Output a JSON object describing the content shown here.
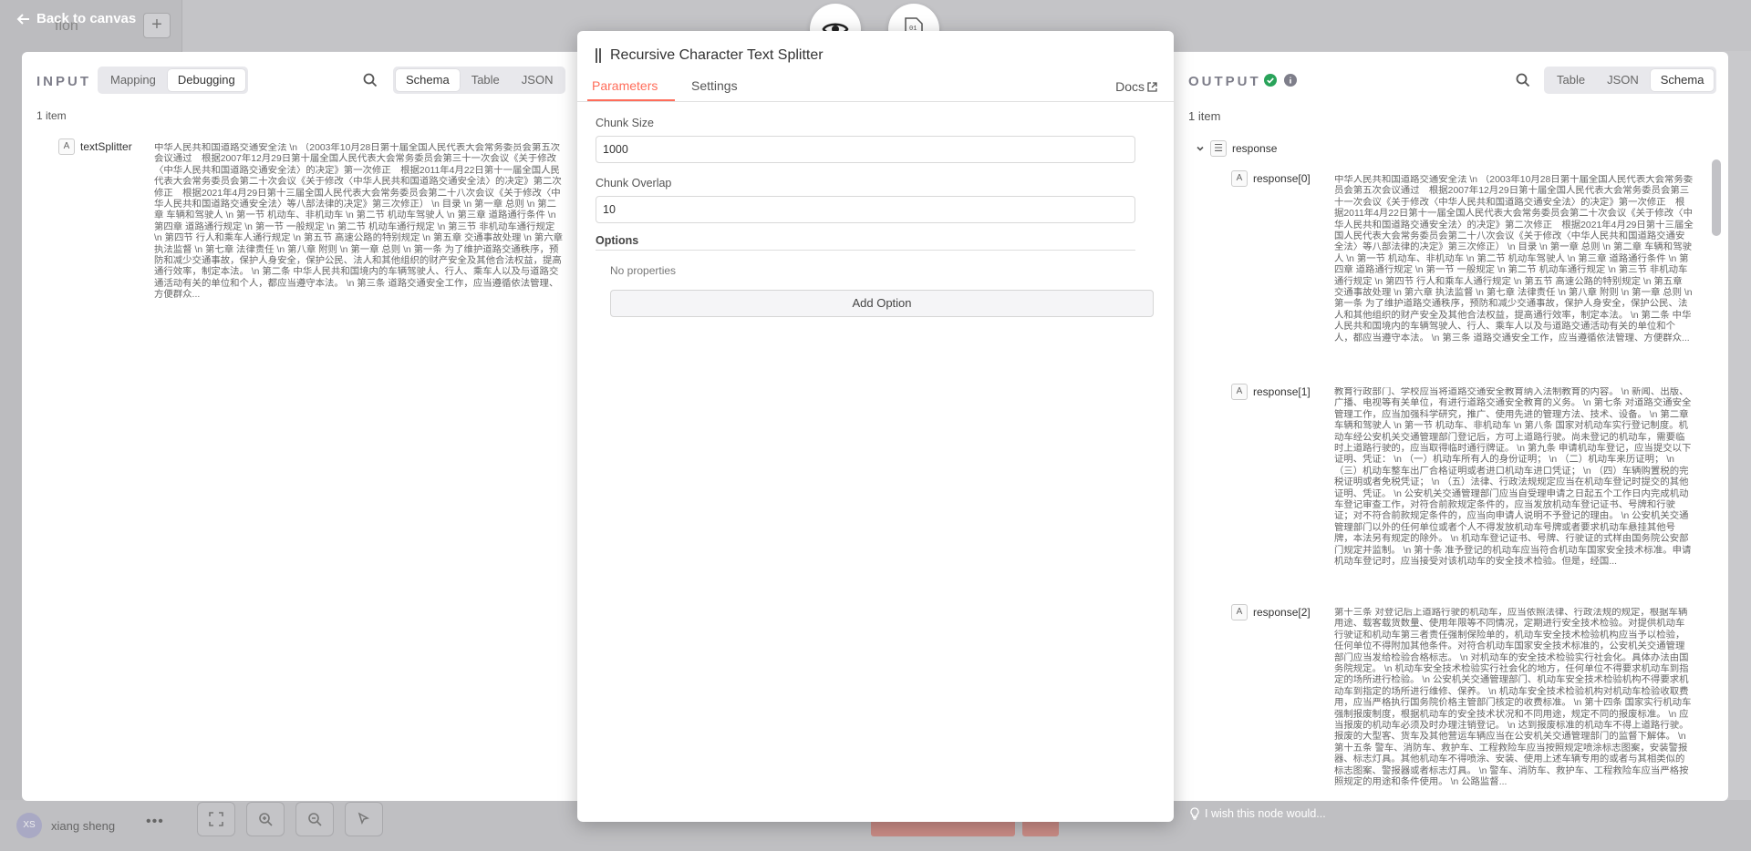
{
  "background": {
    "back_label": "Back to canvas",
    "workflow_title": "flon",
    "add_tab": "+",
    "user_name": "xiang sheng",
    "user_initials": "XS",
    "user_more": "•••"
  },
  "modal": {
    "title": "Recursive Character Text Splitter",
    "tabs": [
      "Parameters",
      "Settings"
    ],
    "docs_label": "Docs",
    "chunk_size_label": "Chunk Size",
    "chunk_size_value": "1000",
    "chunk_overlap_label": "Chunk Overlap",
    "chunk_overlap_value": "10",
    "options_label": "Options",
    "no_properties": "No properties",
    "add_option": "Add Option"
  },
  "input_panel": {
    "title": "INPUT",
    "mode_tabs": [
      "Mapping",
      "Debugging"
    ],
    "active_mode": "Debugging",
    "view_tabs": [
      "Schema",
      "Table",
      "JSON"
    ],
    "active_view": "Schema",
    "count": "1 item",
    "field_type": "A",
    "field_name": "textSplitter",
    "field_value": "中华人民共和国道路交通安全法 \\n （2003年10月28日第十届全国人民代表大会常务委员会第五次会议通过　根据2007年12月29日第十届全国人民代表大会常务委员会第三十一次会议《关于修改〈中华人民共和国道路交通安全法〉的决定》第一次修正　根据2011年4月22日第十一届全国人民代表大会常务委员会第二十次会议《关于修改〈中华人民共和国道路交通安全法〉的决定》第二次修正　根据2021年4月29日第十三届全国人民代表大会常务委员会第二十八次会议《关于修改〈中华人民共和国道路交通安全法〉等八部法律的决定》第三次修正） \\n 目录 \\n 第一章 总则 \\n 第二章 车辆和驾驶人 \\n 第一节 机动车、非机动车 \\n 第二节 机动车驾驶人 \\n 第三章 道路通行条件 \\n 第四章 道路通行规定 \\n 第一节 一般规定 \\n 第二节 机动车通行规定 \\n 第三节 非机动车通行规定 \\n 第四节 行人和乘车人通行规定 \\n 第五节 高速公路的特别规定 \\n 第五章 交通事故处理 \\n 第六章 执法监督 \\n 第七章 法律责任 \\n 第八章 附则 \\n 第一章 总则 \\n 第一条 为了维护道路交通秩序，预防和减少交通事故，保护人身安全，保护公民、法人和其他组织的财产安全及其他合法权益，提高通行效率，制定本法。 \\n 第二条 中华人民共和国境内的车辆驾驶人、行人、乘车人以及与道路交通活动有关的单位和个人，都应当遵守本法。 \\n 第三条 道路交通安全工作，应当遵循依法管理、方便群众..."
  },
  "output_panel": {
    "title": "OUTPUT",
    "view_tabs": [
      "Table",
      "JSON",
      "Schema"
    ],
    "active_view": "Schema",
    "count": "1 item",
    "root_name": "response",
    "items": [
      {
        "type": "A",
        "name": "response[0]",
        "value": "中华人民共和国道路交通安全法 \\n （2003年10月28日第十届全国人民代表大会常务委员会第五次会议通过　根据2007年12月29日第十届全国人民代表大会常务委员会第三十一次会议《关于修改〈中华人民共和国道路交通安全法〉的决定》第一次修正　根据2011年4月22日第十一届全国人民代表大会常务委员会第二十次会议《关于修改〈中华人民共和国道路交通安全法〉的决定》第二次修正　根据2021年4月29日第十三届全国人民代表大会常务委员会第二十八次会议《关于修改〈中华人民共和国道路交通安全法〉等八部法律的决定》第三次修正） \\n 目录 \\n 第一章 总则 \\n 第二章 车辆和驾驶人 \\n 第一节 机动车、非机动车 \\n 第二节 机动车驾驶人 \\n 第三章 道路通行条件 \\n 第四章 道路通行规定 \\n 第一节 一般规定 \\n 第二节 机动车通行规定 \\n 第三节 非机动车通行规定 \\n 第四节 行人和乘车人通行规定 \\n 第五节 高速公路的特别规定 \\n 第五章 交通事故处理 \\n 第六章 执法监督 \\n 第七章 法律责任 \\n 第八章 附则 \\n 第一章 总则 \\n 第一条 为了维护道路交通秩序，预防和减少交通事故，保护人身安全，保护公民、法人和其他组织的财产安全及其他合法权益，提高通行效率，制定本法。 \\n 第二条 中华人民共和国境内的车辆驾驶人、行人、乘车人以及与道路交通活动有关的单位和个人，都应当遵守本法。 \\n 第三条 道路交通安全工作，应当遵循依法管理、方便群众..."
      },
      {
        "type": "A",
        "name": "response[1]",
        "value": "教育行政部门、学校应当将道路交通安全教育纳入法制教育的内容。 \\n 新闻、出版、广播、电视等有关单位，有进行道路交通安全教育的义务。 \\n 第七条 对道路交通安全管理工作，应当加强科学研究，推广、使用先进的管理方法、技术、设备。 \\n 第二章 车辆和驾驶人 \\n 第一节 机动车、非机动车 \\n 第八条 国家对机动车实行登记制度。机动车经公安机关交通管理部门登记后，方可上道路行驶。尚未登记的机动车，需要临时上道路行驶的，应当取得临时通行牌证。 \\n 第九条 申请机动车登记，应当提交以下证明、凭证： \\n （一）机动车所有人的身份证明； \\n （二）机动车来历证明； \\n （三）机动车整车出厂合格证明或者进口机动车进口凭证； \\n （四）车辆购置税的完税证明或者免税凭证； \\n （五）法律、行政法规规定应当在机动车登记时提交的其他证明、凭证。 \\n 公安机关交通管理部门应当自受理申请之日起五个工作日内完成机动车登记审查工作，对符合前款规定条件的，应当发放机动车登记证书、号牌和行驶证；对不符合前款规定条件的，应当向申请人说明不予登记的理由。 \\n 公安机关交通管理部门以外的任何单位或者个人不得发放机动车号牌或者要求机动车悬挂其他号牌，本法另有规定的除外。 \\n 机动车登记证书、号牌、行驶证的式样由国务院公安部门规定并监制。 \\n 第十条 准予登记的机动车应当符合机动车国家安全技术标准。申请机动车登记时，应当接受对该机动车的安全技术检验。但是，经国..."
      },
      {
        "type": "A",
        "name": "response[2]",
        "value": "第十三条 对登记后上道路行驶的机动车，应当依照法律、行政法规的规定，根据车辆用途、载客载货数量、使用年限等不同情况，定期进行安全技术检验。对提供机动车行驶证和机动车第三者责任强制保险单的，机动车安全技术检验机构应当予以检验，任何单位不得附加其他条件。对符合机动车国家安全技术标准的，公安机关交通管理部门应当发给检验合格标志。 \\n 对机动车的安全技术检验实行社会化。具体办法由国务院规定。 \\n 机动车安全技术检验实行社会化的地方，任何单位不得要求机动车到指定的场所进行检验。 \\n 公安机关交通管理部门、机动车安全技术检验机构不得要求机动车到指定的场所进行维修、保养。 \\n 机动车安全技术检验机构对机动车检验收取费用，应当严格执行国务院价格主管部门核定的收费标准。 \\n 第十四条 国家实行机动车强制报废制度，根据机动车的安全技术状况和不同用途，规定不同的报废标准。 \\n 应当报废的机动车必须及时办理注销登记。 \\n 达到报废标准的机动车不得上道路行驶。报废的大型客、货车及其他营运车辆应当在公安机关交通管理部门的监督下解体。 \\n 第十五条 警车、消防车、救护车、工程救险车应当按照规定喷涂标志图案，安装警报器、标志灯具。其他机动车不得喷涂、安装、使用上述车辆专用的或者与其相类似的标志图案、警报器或者标志灯具。 \\n 警车、消防车、救护车、工程救险车应当严格按照规定的用途和条件使用。 \\n 公路监督..."
      }
    ],
    "feedback": "I wish this node would..."
  },
  "icons": {
    "eye": "eye-icon",
    "binary": "binary-file-icon",
    "search": "search-icon",
    "check": "check-circle-icon",
    "info": "info-icon",
    "lightbulb": "lightbulb-icon"
  },
  "colors": {
    "accent": "#ff6d5a",
    "success": "#29a35a"
  }
}
